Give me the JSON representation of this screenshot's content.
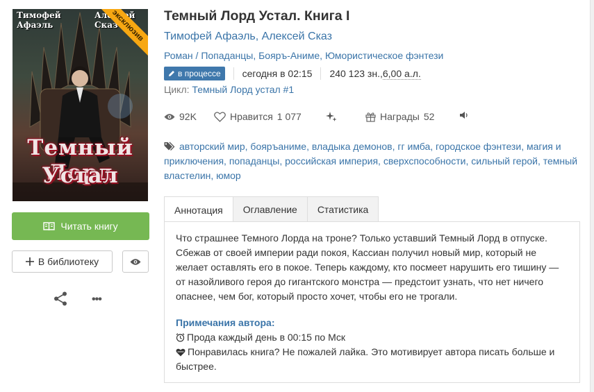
{
  "book": {
    "title": "Темный Лорд Устал. Книга I",
    "authors": [
      "Тимофей Афаэль",
      "Алексей Сказ"
    ],
    "author_sep": ", ",
    "genres": [
      "Роман",
      "Попаданцы",
      "Бояръ-Аниме",
      "Юмористическое фэнтези"
    ],
    "genre_sep_slash": " / ",
    "genre_sep_comma": ", ",
    "status": "в процессе",
    "updated": "сегодня в 02:15",
    "size_prefix": "240 123 зн., ",
    "size_sheets": "6,00 а.л.",
    "cycle_label": "Цикл: ",
    "cycle_name": "Темный Лорд устал #1"
  },
  "cover": {
    "author_left": "Тимофей\nАфаэль",
    "author_right": "Алексей\nСказ",
    "title_line1": "Темный Лорд",
    "title_line2": "Устал",
    "ribbon": "эксклюзив"
  },
  "stats": {
    "views": "92K",
    "likes_label": "Нравится",
    "likes": "1 077",
    "awards_label": "Награды",
    "awards": "52"
  },
  "tags": [
    "авторский мир",
    "бояръаниме",
    "владыка демонов",
    "гг имба",
    "городское фэнтези",
    "магия и приключения",
    "попаданцы",
    "российская империя",
    "сверхспособности",
    "сильный герой",
    "темный властелин",
    "юмор"
  ],
  "tag_sep": ", ",
  "actions": {
    "read": "Читать книгу",
    "library": "В библиотеку"
  },
  "tabs": [
    "Аннотация",
    "Оглавление",
    "Статистика"
  ],
  "annotation": "Что страшнее Темного Лорда на троне? Только уставший Темный Лорд в отпуске. Сбежав от своей империи ради покоя, Кассиан получил новый мир, который не желает оставлять его в покое. Теперь каждому, кто посмеет нарушить его тишину — от назойливого героя до гигантского монстра — предстоит узнать, что нет ничего опаснее, чем бог, который просто хочет, чтобы его не трогали.",
  "notes": {
    "title": "Примечания автора:",
    "line1": "Прода каждый день в 00:15 по Мск",
    "line2": "Понравилась книга? Не пожалей лайка. Это мотивирует автора писать больше и быстрее."
  },
  "colors": {
    "link": "#3a74a8",
    "read_button": "#76b853",
    "status_badge": "#3f78ac",
    "ribbon": "#f7a712"
  }
}
